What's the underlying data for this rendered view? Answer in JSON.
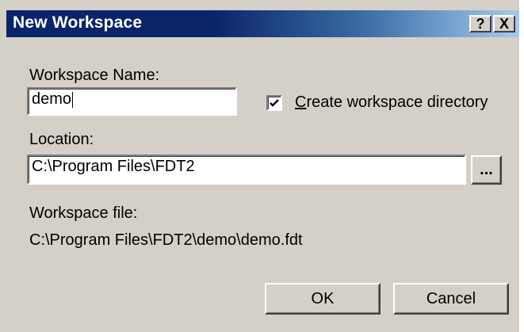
{
  "window": {
    "title": "New Workspace",
    "help_label": "?",
    "close_label": "X"
  },
  "workspace_name": {
    "label": "Workspace Name:",
    "value": "demo"
  },
  "create_dir": {
    "first_char": "C",
    "rest": "reate workspace directory",
    "checked": true
  },
  "location": {
    "label": "Location:",
    "value": "C:\\Program Files\\FDT2",
    "browse_label": "..."
  },
  "workspace_file": {
    "label": "Workspace file:",
    "value": "C:\\Program Files\\FDT2\\demo\\demo.fdt"
  },
  "buttons": {
    "ok": "OK",
    "cancel": "Cancel"
  }
}
